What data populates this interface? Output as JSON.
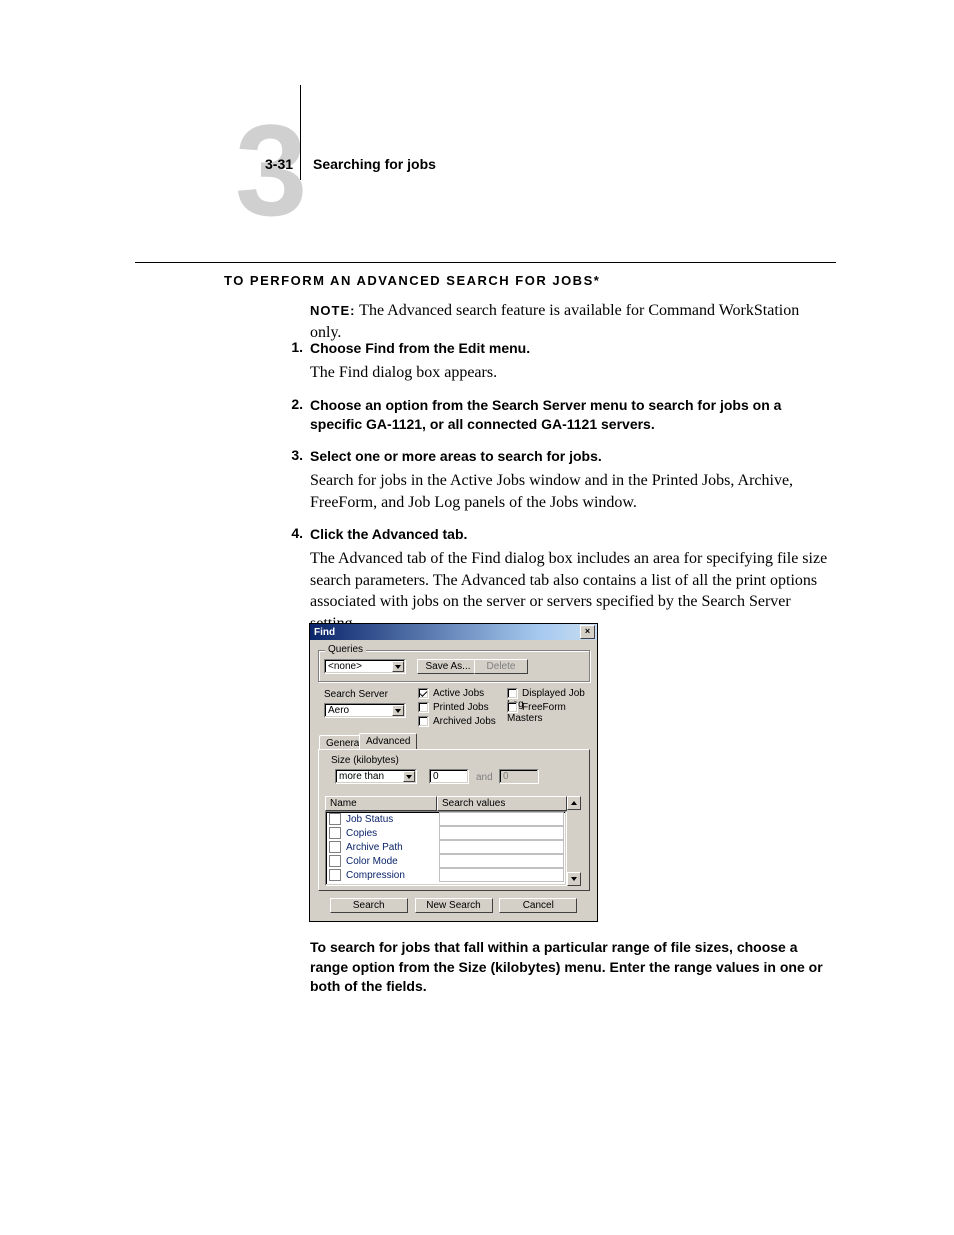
{
  "header": {
    "chapter_number": "3",
    "page_num": "3-31",
    "page_title": "Searching for jobs"
  },
  "section_heading": "To perform an advanced search for jobs*",
  "note_label": "Note:",
  "note_text": "The Advanced search feature is available for Command WorkStation only.",
  "steps": {
    "s1": {
      "num": "1.",
      "title": "Choose Find from the Edit menu.",
      "body": "The Find dialog box appears."
    },
    "s2": {
      "num": "2.",
      "title": "Choose an option from the Search Server menu to search for jobs on a specific GA-1121, or all connected GA-1121 servers."
    },
    "s3": {
      "num": "3.",
      "title": "Select one or more areas to search for jobs.",
      "body": "Search for jobs in the Active Jobs window and in the Printed Jobs, Archive, FreeForm, and Job Log panels of the Jobs window."
    },
    "s4": {
      "num": "4.",
      "title": "Click the Advanced tab.",
      "body": "The Advanced tab of the Find dialog box includes an area for specifying file size search parameters. The Advanced tab also contains a list of all the print options associated with jobs on the server or servers specified by the Search Server setting."
    }
  },
  "dialog": {
    "title": "Find",
    "queries": {
      "label": "Queries",
      "value": "<none>",
      "save_as": "Save As...",
      "delete": "Delete"
    },
    "search_server": {
      "label": "Search Server",
      "value": "Aero"
    },
    "checks": {
      "active": "Active Jobs",
      "printed": "Printed Jobs",
      "archived": "Archived Jobs",
      "joblog": "Displayed Job Log",
      "freeform": "FreeForm Masters"
    },
    "tabs": {
      "general": "General",
      "advanced": "Advanced"
    },
    "size": {
      "label": "Size (kilobytes)",
      "mode": "more than",
      "from": "0",
      "and": "and",
      "to": "0"
    },
    "list": {
      "col_name": "Name",
      "col_values": "Search values",
      "rows": [
        "Job Status",
        "Copies",
        "Archive Path",
        "Color Mode",
        "Compression"
      ]
    },
    "buttons": {
      "search": "Search",
      "new_search": "New Search",
      "cancel": "Cancel"
    }
  },
  "closing": "To search for jobs that fall within a particular range of file sizes, choose a range option from the Size (kilobytes) menu. Enter the range values in one or both of the fields."
}
